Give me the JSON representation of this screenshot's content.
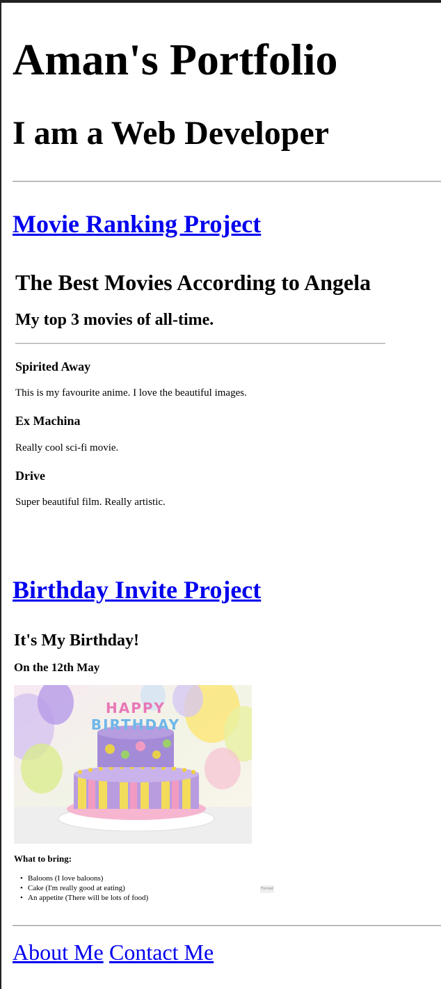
{
  "header": {
    "title": "Aman's Portfolio",
    "subtitle": "I am a Web Developer"
  },
  "projects": [
    {
      "link_text": "Movie Ranking Project",
      "embed": {
        "title": "The Best Movies According to Angela",
        "subtitle": "My top 3 movies of all-time.",
        "movies": [
          {
            "name": "Spirited Away",
            "description": "This is my favourite anime. I love the beautiful images."
          },
          {
            "name": "Ex Machina",
            "description": "Really cool sci-fi movie."
          },
          {
            "name": "Drive",
            "description": "Super beautiful film. Really artistic."
          }
        ]
      }
    },
    {
      "link_text": "Birthday Invite Project",
      "embed": {
        "title": "It's My Birthday!",
        "date": "On the 12th May",
        "image_alt": "birthday cake",
        "cake_banner": "HAPPY BIRTHDAY",
        "bring_heading": "What to bring:",
        "items": [
          "Baloons (I love baloons)",
          "Cake (I'm really good at eating)",
          "An appetite (There will be lots of food)"
        ],
        "badge": "Formet"
      }
    }
  ],
  "footer": {
    "about_link": "About Me",
    "contact_link": "Contact Me"
  },
  "colors": {
    "link": "#0000ee",
    "text": "#000000",
    "background": "#ffffff"
  }
}
